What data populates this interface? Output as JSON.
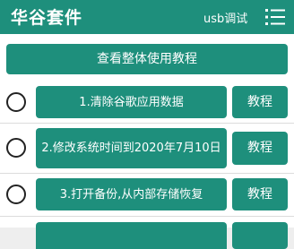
{
  "appbar": {
    "title": "华谷套件",
    "usb_debug": "usb调试",
    "menu_icon": "list-menu-icon",
    "color": "#1e8f7c"
  },
  "overview_button": "查看整体使用教程",
  "steps": [
    {
      "label": "1.清除谷歌应用数据",
      "tutorial": "教程",
      "checked": false
    },
    {
      "label": "2.修改系统时间到2020年7月10日",
      "tutorial": "教程",
      "checked": false
    },
    {
      "label": "3.打开备份,从内部存储恢复",
      "tutorial": "教程",
      "checked": false
    },
    {
      "label": "",
      "tutorial": "",
      "checked": false
    }
  ]
}
